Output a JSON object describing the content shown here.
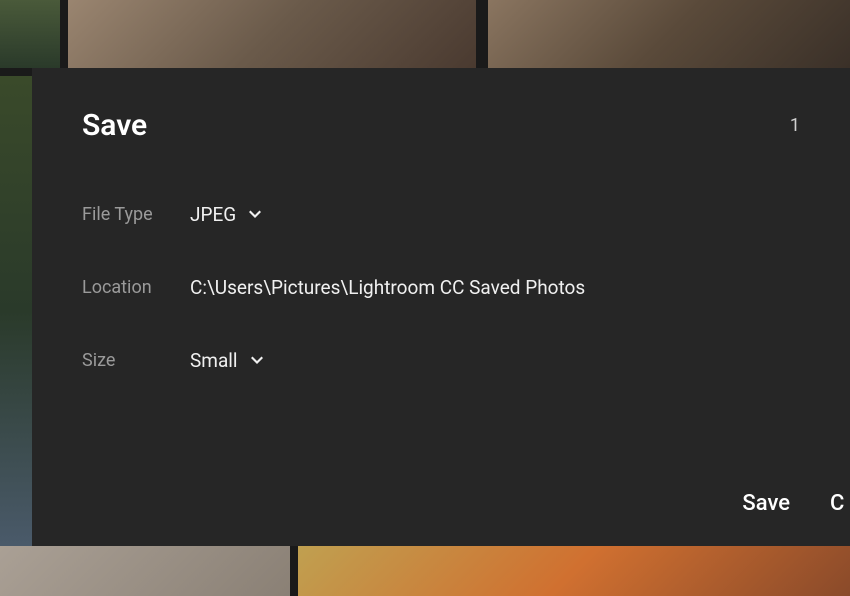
{
  "dialog": {
    "title": "Save",
    "count": "1",
    "fileType": {
      "label": "File Type",
      "value": "JPEG"
    },
    "location": {
      "label": "Location",
      "value": "C:\\Users\\Pictures\\Lightroom CC Saved Photos"
    },
    "size": {
      "label": "Size",
      "value": "Small"
    },
    "actions": {
      "save": "Save",
      "cancel": "C"
    }
  }
}
